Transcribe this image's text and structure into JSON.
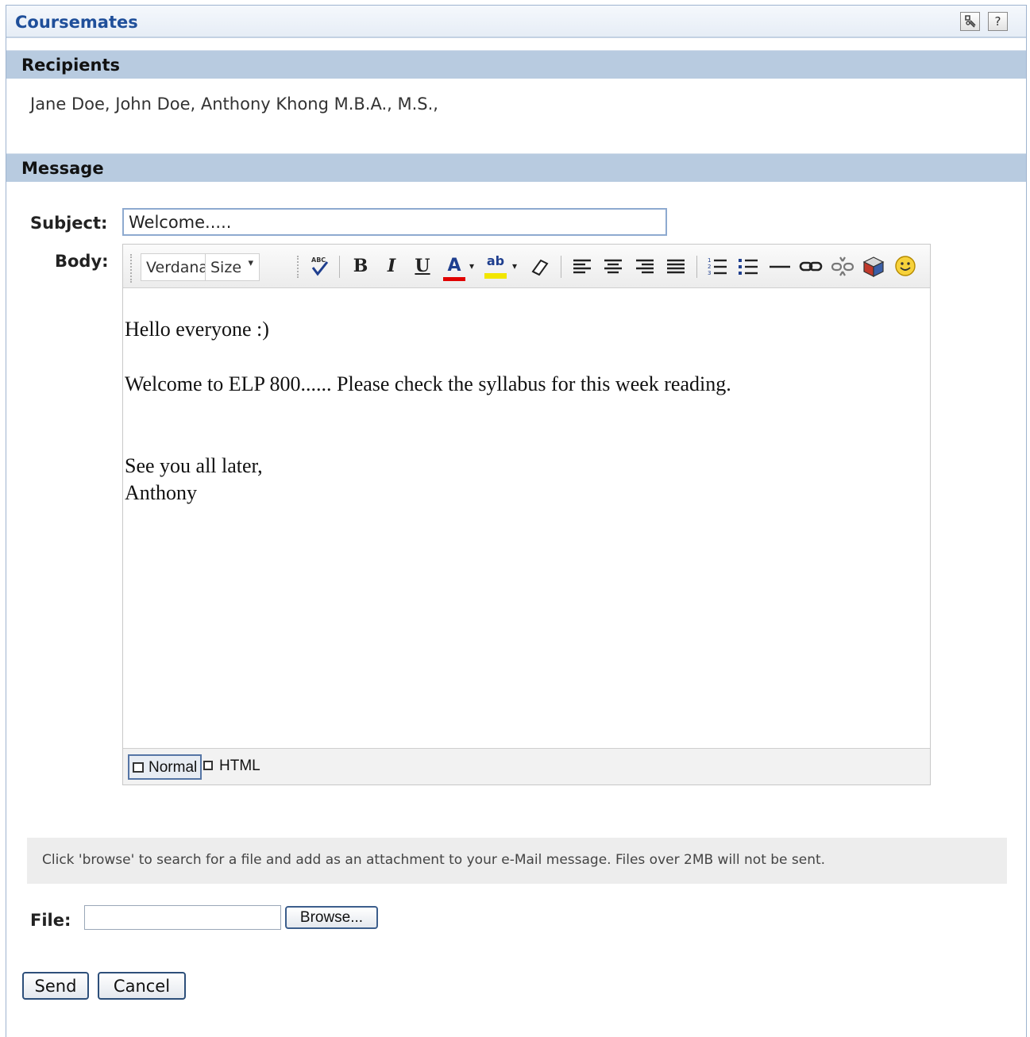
{
  "portlet": {
    "title": "Coursemates",
    "icons": [
      "settings-icon",
      "help-icon"
    ],
    "help_label": "?"
  },
  "recipients": {
    "header": "Recipients",
    "list": "Jane Doe, John Doe,  Anthony Khong M.B.A., M.S.,"
  },
  "message": {
    "header": "Message",
    "subject_label": "Subject:",
    "subject_value": "Welcome.....",
    "body_label": "Body:",
    "toolbar": {
      "font": "Verdana",
      "size": "Size",
      "size_caret": "▾",
      "bold": "B",
      "italic": "I",
      "underline": "U",
      "font_color": "A",
      "highlight": "ab",
      "font_color_swatch": "#e00000",
      "highlight_swatch": "#f2e600"
    },
    "body": {
      "greeting": "Hello everyone :)",
      "paragraph": "Welcome to ELP 800...... Please check the syllabus for this week reading.",
      "closing": "See you all later,",
      "signature": "Anthony"
    },
    "modes": {
      "normal": "Normal",
      "html": "HTML",
      "active": "Normal"
    }
  },
  "attachment": {
    "note": "Click 'browse' to search for a file and add as an attachment to your e-Mail message. Files over 2MB will not be sent.",
    "file_label": "File:",
    "browse_label": "Browse..."
  },
  "actions": {
    "send": "Send",
    "cancel": "Cancel"
  }
}
